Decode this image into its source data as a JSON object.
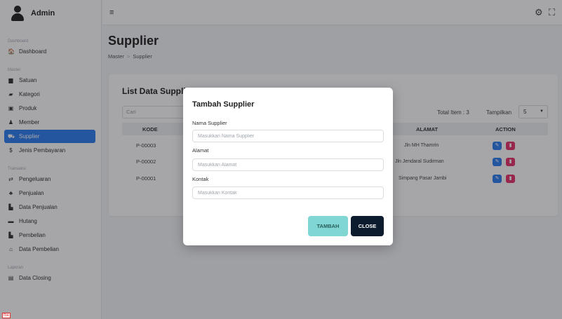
{
  "brand": {
    "name": "Admin"
  },
  "sidebar": {
    "sections": [
      {
        "label": "Dashboard",
        "items": [
          {
            "label": "Dashboard",
            "icon": "home-icon",
            "glyph": "🏠"
          }
        ]
      },
      {
        "label": "Master",
        "items": [
          {
            "label": "Satuan",
            "icon": "folder-icon",
            "glyph": "▆"
          },
          {
            "label": "Kategori",
            "icon": "folder-open-icon",
            "glyph": "▰"
          },
          {
            "label": "Produk",
            "icon": "box-icon",
            "glyph": "▣"
          },
          {
            "label": "Member",
            "icon": "user-icon",
            "glyph": "♟"
          },
          {
            "label": "Supplier",
            "icon": "truck-icon",
            "glyph": "⛟",
            "active": true
          },
          {
            "label": "Jenis Pembayaran",
            "icon": "dollar-icon",
            "glyph": "$"
          }
        ]
      },
      {
        "label": "Transaksi",
        "items": [
          {
            "label": "Pengeluaran",
            "icon": "exchange-icon",
            "glyph": "⇄"
          },
          {
            "label": "Penjualan",
            "icon": "bag-icon",
            "glyph": "♣"
          },
          {
            "label": "Data Penjualan",
            "icon": "data-icon",
            "glyph": "▙"
          },
          {
            "label": "Hutang",
            "icon": "money-icon",
            "glyph": "▬"
          },
          {
            "label": "Pembelian",
            "icon": "cart-icon",
            "glyph": "▙"
          },
          {
            "label": "Data Pembelian",
            "icon": "list-icon",
            "glyph": "⌂"
          }
        ]
      },
      {
        "label": "Laporan",
        "items": [
          {
            "label": "Data Closing",
            "icon": "document-icon",
            "glyph": "▤"
          }
        ]
      }
    ]
  },
  "topbar": {
    "menu_icon": "≡",
    "settings_icon": "⚙",
    "expand_icon": "⛶"
  },
  "page": {
    "title": "Supplier",
    "breadcrumb": [
      "Master",
      "Supplier"
    ],
    "breadcrumb_sep": ">"
  },
  "card": {
    "title": "List Data Supplier",
    "search_placeholder": "Cari",
    "total_label": "Total Item : 3",
    "tampilkan_label": "Tampilkan",
    "page_size": "5",
    "headers": {
      "kode": "KODE",
      "alamat": "ALAMAT",
      "action": "ACTION"
    },
    "rows": [
      {
        "kode": "P-00003",
        "alamat": "Jln MH Thamrin"
      },
      {
        "kode": "P-00002",
        "alamat": "Jln Jendaral Sudirman"
      },
      {
        "kode": "P-00001",
        "alamat": "Simpang Pasar Jambi"
      }
    ]
  },
  "modal": {
    "title": "Tambah Supplier",
    "fields": [
      {
        "label": "Nama Supplier",
        "placeholder": "Masukkan Nama Supplier"
      },
      {
        "label": "Alamat",
        "placeholder": "Masukkan Alamat"
      },
      {
        "label": "Kontak",
        "placeholder": "Masukkan Kontak"
      }
    ],
    "tambah_label": "TAMBAH",
    "close_label": "CLOSE"
  },
  "corner_tag": "ftie"
}
